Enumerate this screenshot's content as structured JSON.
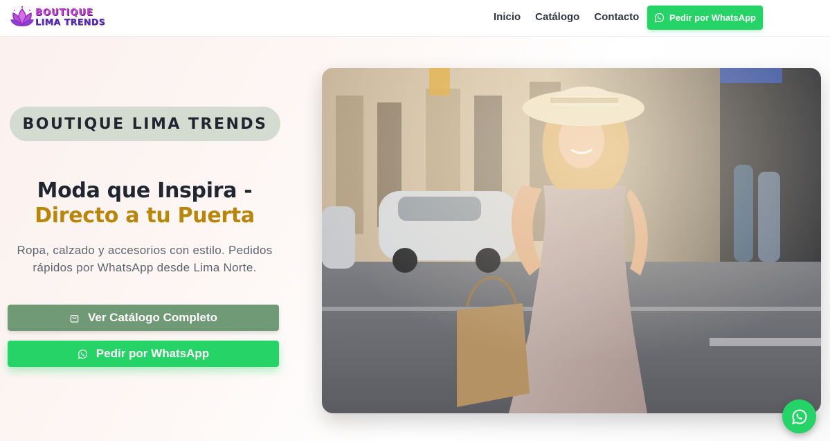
{
  "brand": {
    "line1": "BOUTIQUE",
    "line2": "LIMA TRENDS"
  },
  "nav": {
    "items": [
      "Inicio",
      "Catálogo",
      "Contacto"
    ],
    "whatsapp_label": "Pedir por WhatsApp"
  },
  "hero": {
    "badge": "BOUTIQUE LIMA TRENDS",
    "headline_main": "Moda que Inspira -",
    "headline_accent": "Directo a tu Puerta",
    "subtitle": "Ropa, calzado y accesorios con estilo. Pedidos rápidos por WhatsApp desde Lima Norte.",
    "catalog_button": "Ver Catálogo Completo",
    "whatsapp_button": "Pedir por WhatsApp"
  },
  "icons": {
    "logo": "lotus-logo-icon",
    "whatsapp": "whatsapp-icon",
    "bag": "shopping-bag-icon"
  },
  "colors": {
    "whatsapp_green": "#25d366",
    "sage_green": "#6f9a75",
    "badge_bg": "#d4dcd2",
    "accent_gold": "#b8860b",
    "dark_text": "#1f2630",
    "logo_pink": "#c640d6",
    "logo_purple": "#5a2bbb"
  }
}
